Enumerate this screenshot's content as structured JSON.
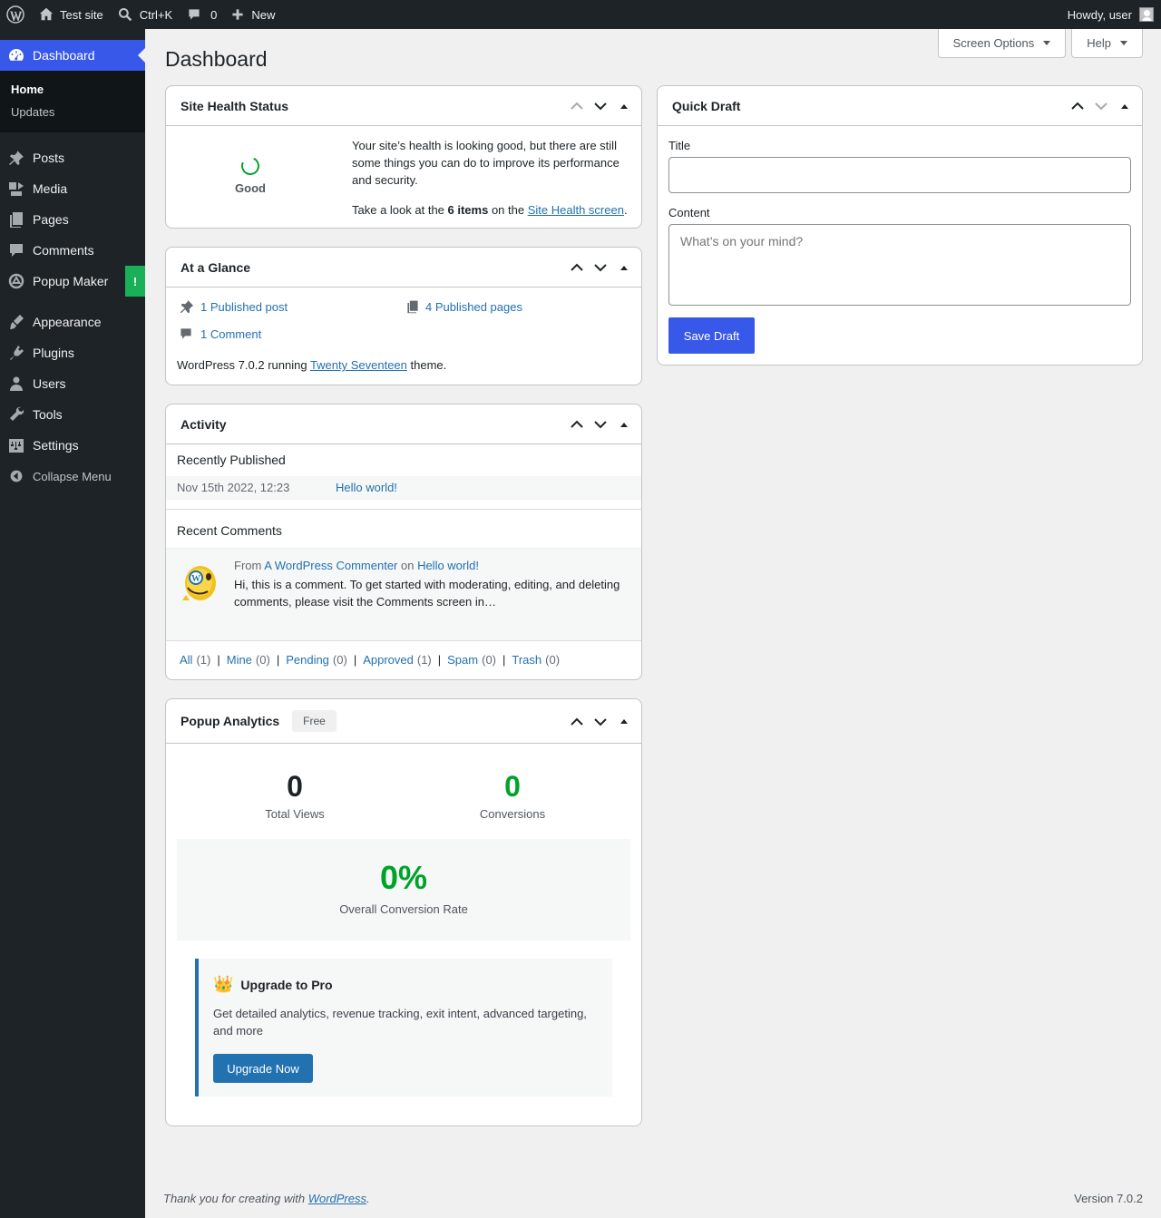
{
  "adminbar": {
    "site_name": "Test site",
    "search_shortcut": "Ctrl+K",
    "comments_count": "0",
    "new_label": "New",
    "howdy": "Howdy, user"
  },
  "sidebar": {
    "dashboard": "Dashboard",
    "submenu": [
      "Home",
      "Updates"
    ],
    "items": [
      "Posts",
      "Media",
      "Pages",
      "Comments",
      "Popup Maker",
      "Appearance",
      "Plugins",
      "Users",
      "Tools",
      "Settings"
    ],
    "popup_badge": "!",
    "collapse": "Collapse Menu"
  },
  "screen_meta": {
    "screen_options": "Screen Options",
    "help": "Help"
  },
  "page_title": "Dashboard",
  "site_health": {
    "title": "Site Health Status",
    "status": "Good",
    "message": "Your site’s health is looking good, but there are still some things you can do to improve its performance and security.",
    "take_look_pre": "Take a look at the ",
    "items_count": "6 items",
    "take_look_mid": " on the ",
    "screen_link": "Site Health screen",
    "take_look_post": "."
  },
  "at_a_glance": {
    "title": "At a Glance",
    "posts": "1 Published post",
    "pages": "4 Published pages",
    "comments": "1 Comment",
    "running_pre": "WordPress 7.0.2 running ",
    "theme_link": "Twenty Seventeen",
    "running_post": " theme."
  },
  "activity": {
    "title": "Activity",
    "recently_published": "Recently Published",
    "post_date": "Nov 15th 2022, 12:23",
    "post_title": "Hello world!",
    "recent_comments": "Recent Comments",
    "from": "From ",
    "commenter": "A WordPress Commenter",
    "on": " on ",
    "comment_post": "Hello world!",
    "comment_excerpt": "Hi, this is a comment. To get started with moderating, editing, and deleting comments, please visit the Comments screen in…",
    "filters": [
      {
        "label": "All",
        "count": "(1)"
      },
      {
        "label": "Mine",
        "count": "(0)"
      },
      {
        "label": "Pending",
        "count": "(0)"
      },
      {
        "label": "Approved",
        "count": "(1)"
      },
      {
        "label": "Spam",
        "count": "(0)"
      },
      {
        "label": "Trash",
        "count": "(0)"
      }
    ],
    "separator": "|"
  },
  "popup_analytics": {
    "title": "Popup Analytics",
    "badge": "Free",
    "total_views": "0",
    "total_views_label": "Total Views",
    "conversions": "0",
    "conversions_label": "Conversions",
    "rate": "0%",
    "rate_label": "Overall Conversion Rate",
    "upgrade_icon": "👑",
    "upgrade_title": "Upgrade to Pro",
    "upgrade_text": "Get detailed analytics, revenue tracking, exit intent, advanced targeting, and more",
    "upgrade_button": "Upgrade Now"
  },
  "quick_draft": {
    "title": "Quick Draft",
    "title_label": "Title",
    "title_value": "",
    "content_label": "Content",
    "content_placeholder": "What’s on your mind?",
    "save_button": "Save Draft"
  },
  "footer": {
    "thanks_pre": "Thank you for creating with ",
    "wp_link": "WordPress",
    "thanks_post": ".",
    "version": "Version 7.0.2"
  },
  "colors": {
    "accent": "#3858e9",
    "link": "#2271b1",
    "good": "#00a32a",
    "adminbar": "#1d2327"
  }
}
